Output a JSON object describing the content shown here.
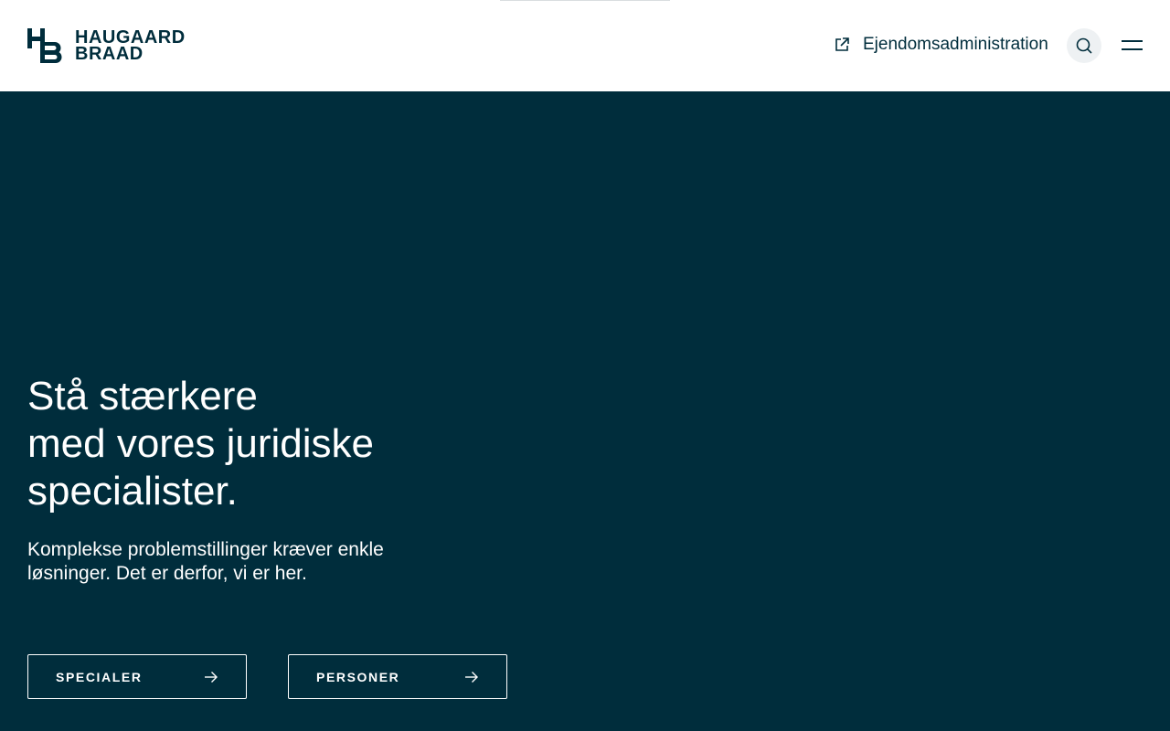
{
  "brand": {
    "name_line1": "HAUGAARD",
    "name_line2": "BRAAD",
    "mark": "HB-monogram-icon",
    "color": "#002d3c"
  },
  "header": {
    "external_link_label": "Ejendomsadministration",
    "external_link_icon": "external-link-icon",
    "search_icon": "search-icon",
    "menu_icon": "hamburger-menu-icon"
  },
  "hero": {
    "title": "Stå stærkere\nmed vores juridiske\nspecialister.",
    "subtitle": "Komplekse problemstillinger kræver enkle løsninger. Det er derfor, vi er her.",
    "buttons": [
      {
        "label": "SPECIALER",
        "icon": "arrow-right-icon"
      },
      {
        "label": "PERSONER",
        "icon": "arrow-right-icon"
      }
    ],
    "background_color": "#002d3c",
    "text_color": "#ffffff"
  }
}
